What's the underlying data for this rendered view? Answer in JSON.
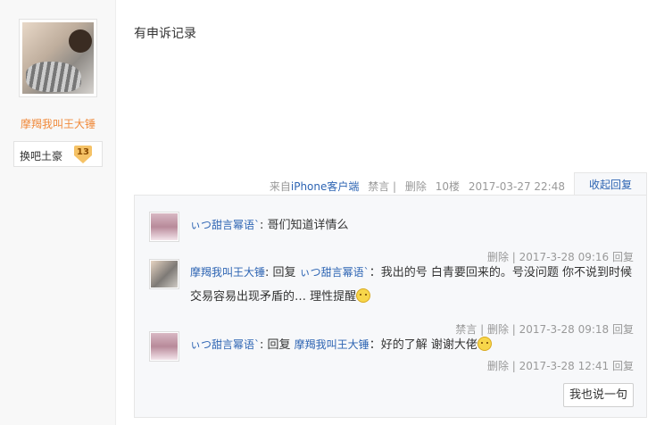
{
  "author": {
    "name": "摩羯我叫王大锤",
    "badge_label": "换吧土豪",
    "badge_level": "13"
  },
  "post": {
    "content": "有申诉记录"
  },
  "tail": {
    "source_prefix": "来自",
    "source_client": "iPhone客户端",
    "ban": "禁言",
    "delete": "删除",
    "floor": "10楼",
    "time": "2017-03-27 22:48",
    "toggle": "收起回复"
  },
  "replies": [
    {
      "user": "ぃつ甜言幂语`",
      "prefix": "",
      "text": ": 哥们知道详情么",
      "meta_actions": "删除 |",
      "time": "2017-3-28 09:16",
      "reply": "回复"
    },
    {
      "user": "摩羯我叫王大锤",
      "prefix": ": 回复",
      "reply_to": "ぃつ甜言幂语`",
      "text": "：我出的号 白青要回来的。号没问题 你不说到时候交易容易出现矛盾的… 理性提醒",
      "meta_actions": "禁言 | 删除 |",
      "time": "2017-3-28 09:18",
      "reply": "回复"
    },
    {
      "user": "ぃつ甜言幂语`",
      "prefix": ": 回复",
      "reply_to": "摩羯我叫王大锤",
      "text": "：好的了解 谢谢大佬",
      "meta_actions": "删除 |",
      "time": "2017-3-28 12:41",
      "reply": "回复"
    }
  ],
  "say_button": "我也说一句",
  "colors": {
    "link": "#2d64b3",
    "author_name": "#f08a3b",
    "muted": "#999999"
  }
}
